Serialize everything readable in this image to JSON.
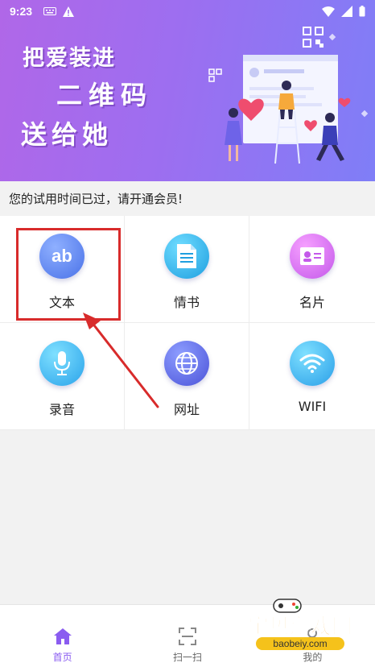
{
  "status_bar": {
    "time": "9:23"
  },
  "banner": {
    "slogan_line1": "把爱装进",
    "slogan_line2": "二维码",
    "slogan_line3": "送给她"
  },
  "notice": "您的试用时间已过，请开通会员!",
  "grid": {
    "items": [
      {
        "label": "文本",
        "icon": "ab-text-icon"
      },
      {
        "label": "情书",
        "icon": "letter-document-icon"
      },
      {
        "label": "名片",
        "icon": "business-card-icon"
      },
      {
        "label": "录音",
        "icon": "microphone-icon"
      },
      {
        "label": "网址",
        "icon": "globe-icon"
      },
      {
        "label": "WIFI",
        "icon": "wifi-icon"
      }
    ]
  },
  "nav": {
    "items": [
      {
        "label": "首页",
        "icon": "home-icon",
        "active": true
      },
      {
        "label": "扫一扫",
        "icon": "scan-icon",
        "active": false
      },
      {
        "label": "我的",
        "icon": "profile-icon",
        "active": false
      }
    ]
  },
  "watermark": {
    "title": "宝贝游戏网",
    "url": "baobeiy.com"
  },
  "colors": {
    "accent": "#8a5cf0",
    "highlight": "#d82b2b"
  }
}
